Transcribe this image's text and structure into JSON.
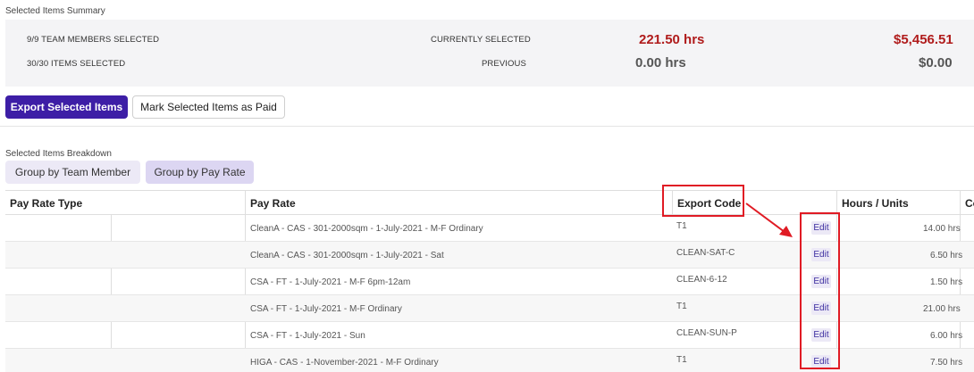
{
  "summary": {
    "title": "Selected Items Summary",
    "team_members_selected": "9/9 TEAM MEMBERS SELECTED",
    "items_selected": "30/30 ITEMS SELECTED",
    "currently_selected_label": "CURRENTLY SELECTED",
    "previous_label": "PREVIOUS",
    "current_hours": "221.50 hrs",
    "current_amount": "$5,456.51",
    "previous_hours": "0.00 hrs",
    "previous_amount": "$0.00"
  },
  "actions": {
    "export_label": "Export Selected Items",
    "mark_paid_label": "Mark Selected Items as Paid"
  },
  "breakdown": {
    "title": "Selected Items Breakdown",
    "group_by_team_member": "Group by Team Member",
    "group_by_pay_rate": "Group by Pay Rate"
  },
  "table": {
    "headers": {
      "pay_rate_type": "Pay Rate Type",
      "pay_rate": "Pay Rate",
      "export_code": "Export Code",
      "hours_units": "Hours / Units",
      "cost_partial": "Co"
    },
    "edit_label": "Edit",
    "rows": [
      {
        "pay_rate": "CleanA - CAS - 301-2000sqm - 1-July-2021 - M-F Ordinary",
        "export_code": "T1",
        "hours": "14.00 hrs"
      },
      {
        "pay_rate": "CleanA - CAS - 301-2000sqm - 1-July-2021 - Sat",
        "export_code": "CLEAN-SAT-C",
        "hours": "6.50 hrs"
      },
      {
        "pay_rate": "CSA - FT - 1-July-2021 - M-F 6pm-12am",
        "export_code": "CLEAN-6-12",
        "hours": "1.50 hrs"
      },
      {
        "pay_rate": "CSA - FT - 1-July-2021 - M-F Ordinary",
        "export_code": "T1",
        "hours": "21.00 hrs"
      },
      {
        "pay_rate": "CSA - FT - 1-July-2021 - Sun",
        "export_code": "CLEAN-SUN-P",
        "hours": "6.00 hrs"
      },
      {
        "pay_rate": "HIGA - CAS - 1-November-2021 - M-F Ordinary",
        "export_code": "T1",
        "hours": "7.50 hrs"
      }
    ]
  },
  "colors": {
    "accent": "#3d1ea6",
    "amount_red": "#b01c1c",
    "annotation_red": "#e01b24"
  }
}
